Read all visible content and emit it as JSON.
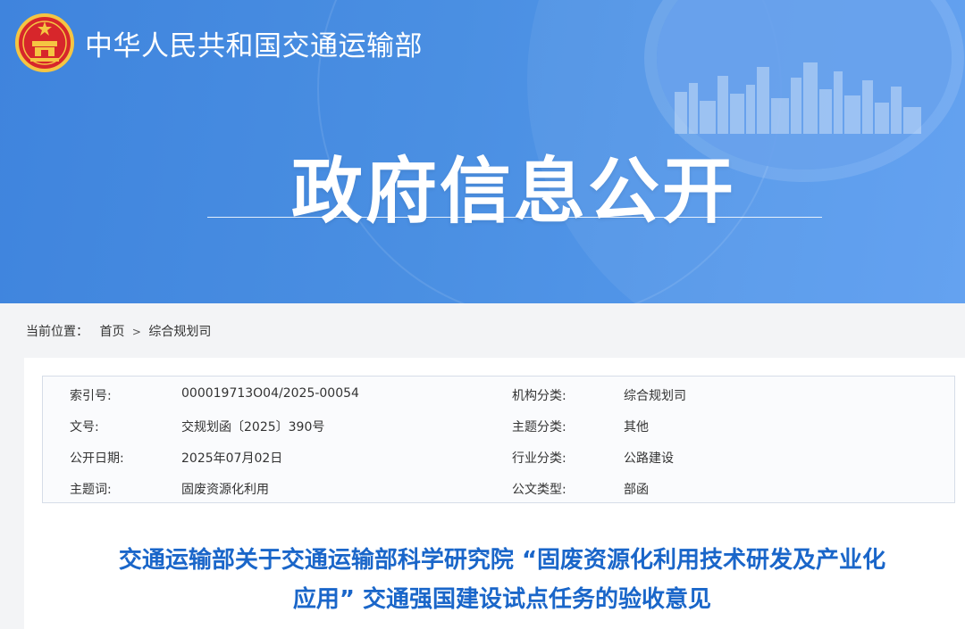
{
  "header": {
    "site_name": "中华人民共和国交通运输部",
    "banner_title": "政府信息公开",
    "emblem_icon": "national-emblem-icon",
    "colors": {
      "banner": "#4a8fe2",
      "title_blue": "#1a66c9"
    }
  },
  "breadcrumb": {
    "label": "当前位置：",
    "items": [
      "首页",
      "综合规划司"
    ],
    "separator": ">"
  },
  "meta": {
    "rows": [
      {
        "k1": "索引号:",
        "v1": "000019713O04/2025-00054",
        "k2": "机构分类:",
        "v2": "综合规划司"
      },
      {
        "k1": "文号:",
        "v1": "交规划函〔2025〕390号",
        "k2": "主题分类:",
        "v2": "其他"
      },
      {
        "k1": "公开日期:",
        "v1": "2025年07月02日",
        "k2": "行业分类:",
        "v2": "公路建设"
      },
      {
        "k1": "主题词:",
        "v1": "固废资源化利用",
        "k2": "公文类型:",
        "v2": "部函"
      }
    ]
  },
  "document": {
    "title_line1": "交通运输部关于交通运输部科学研究院 “固废资源化利用技术研发及产业化",
    "title_line2": "应用” 交通强国建设试点任务的验收意见"
  }
}
